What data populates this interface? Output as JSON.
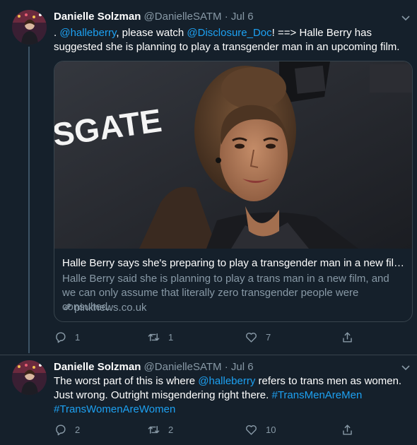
{
  "tweets": [
    {
      "name": "Danielle Solzman",
      "handle": "@DanielleSATM",
      "separator": "·",
      "date": "Jul 6",
      "text": {
        "prefix": ". ",
        "mention1": "@halleberry",
        "part2": ", please watch ",
        "mention2": "@Disclosure_Doc",
        "part3": "! ==> Halle Berry has suggested she is planning to play a transgender man in an upcoming film."
      },
      "card": {
        "backdrop_text": "SGATE",
        "title": "Halle Berry says she's preparing to play a transgender man in a new film...",
        "description": "Halle Berry said she is planning to play a trans man in a new film, and we can only assume that literally zero transgender people were consulted.",
        "domain": "pinknews.co.uk"
      },
      "counts": {
        "replies": "1",
        "retweets": "1",
        "likes": "7"
      }
    },
    {
      "name": "Danielle Solzman",
      "handle": "@DanielleSATM",
      "separator": "·",
      "date": "Jul 6",
      "text": {
        "part1": "The worst part of this is where ",
        "mention1": "@halleberry",
        "part2": " refers to trans men as women. Just wrong. Outright misgendering right there. ",
        "hashtag1": "#TransMenAreMen",
        "hashtag2": "#TransWomenAreWomen"
      },
      "counts": {
        "replies": "2",
        "retweets": "2",
        "likes": "10"
      }
    }
  ],
  "colors": {
    "background": "#15202b",
    "border": "#38444d",
    "link": "#1da1f2",
    "secondary_text": "#8899a6",
    "primary_text": "#ffffff"
  },
  "icons": [
    "chevron-down-icon",
    "reply-icon",
    "retweet-icon",
    "like-icon",
    "share-icon",
    "link-icon"
  ]
}
